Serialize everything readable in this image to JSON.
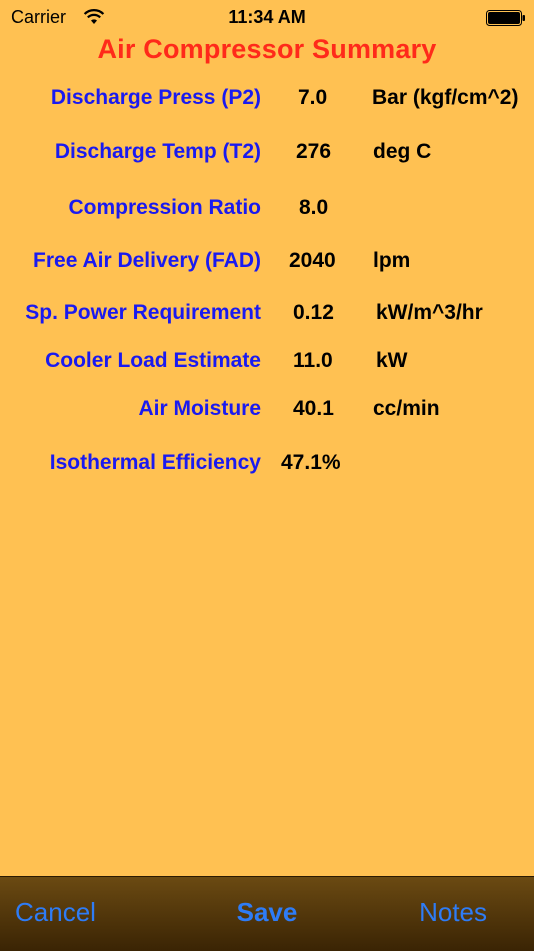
{
  "status_bar": {
    "carrier": "Carrier",
    "time": "11:34 AM",
    "wifi_icon": "wifi-icon",
    "battery_icon": "battery-icon"
  },
  "title": "Air Compressor Summary",
  "rows": [
    {
      "label": "Discharge Press (P2)",
      "value": "7.0",
      "unit": "Bar (kgf/cm^2)"
    },
    {
      "label": "Discharge Temp (T2)",
      "value": "276",
      "unit": "deg C"
    },
    {
      "label": "Compression Ratio",
      "value": "8.0",
      "unit": ""
    },
    {
      "label": "Free Air Delivery (FAD)",
      "value": "2040",
      "unit": "lpm"
    },
    {
      "label": "Sp. Power Requirement",
      "value": "0.12",
      "unit": "kW/m^3/hr"
    },
    {
      "label": "Cooler Load Estimate",
      "value": "11.0",
      "unit": "kW"
    },
    {
      "label": "Air Moisture",
      "value": "40.1",
      "unit": "cc/min"
    },
    {
      "label": "Isothermal Efficiency",
      "value": "47.1%",
      "unit": ""
    }
  ],
  "toolbar": {
    "cancel_label": "Cancel",
    "save_label": "Save",
    "notes_label": "Notes"
  },
  "colors": {
    "background": "#FFC152",
    "title": "#FF2A1A",
    "label": "#1A1AF0",
    "toolbar_button": "#2E7CF6"
  }
}
